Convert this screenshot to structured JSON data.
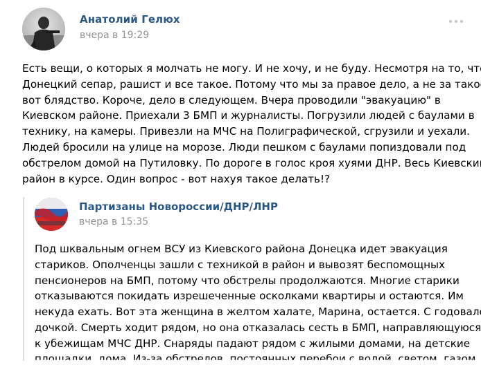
{
  "post": {
    "author_name": "Анатолий Гелюх",
    "date": "вчера в 19:29",
    "more_icon": "ellipsis-icon",
    "text_lines": [
      "Есть вещи, о которых я молчать не могу. И не хочу, и не буду. Несмотря на то, что я",
      "Донецкий сепар, рашист и все такое. Потому что мы за правое дело, а не за такое",
      "вот блядство. Короче, дело в следующем. Вчера проводили \"эвакуацию\" в",
      "Киевском районе. Приехали 3 БМП и журналисты. Погрузили людей с баулами в",
      "технику, на камеры. Привезли на МЧС на Полиграфической, сгрузили и уехали.",
      "Людей бросили на улице на морозе. Люди пешком с баулами попиздовали под",
      "обстрелом домой на Путиловку. По дороге в голос кроя хуями ДНР. Весь Киевский",
      "район в курсе. Один вопрос - вот нахуя такое делать!?"
    ]
  },
  "repost": {
    "author_name": "Партизаны Новороссии/ДНР/ЛНР",
    "date": "вчера в 15:35",
    "text_lines": [
      "Под шквальным огнем ВСУ из Киевского района Донецка идет эвакуация",
      "стариков. Ополченцы зашли с техникой в район и вывозят беспомощных",
      "пенсионеров на БМП, потому что обстрелы продолжаются. Многие старики",
      "отказываются покидать изрешеченные осколками квартиры и остаются. Им",
      "некуда ехать. Вот эта женщина в желтом халате, Марина, остается. С годовалой",
      "дочкой. Смерть ходит рядом, но она отказалась сесть в БМП, направляющуюся",
      "к убежищам МЧС ДНР. Снаряды падают рядом с жилыми домами, на детские",
      "площадки, дома. Из-за обстрелов, постоянных перебои с водой, светом, газом"
    ]
  },
  "colors": {
    "link": "#2a5885",
    "meta": "#939393",
    "text": "#000000",
    "quote_border": "#d7dee6"
  }
}
